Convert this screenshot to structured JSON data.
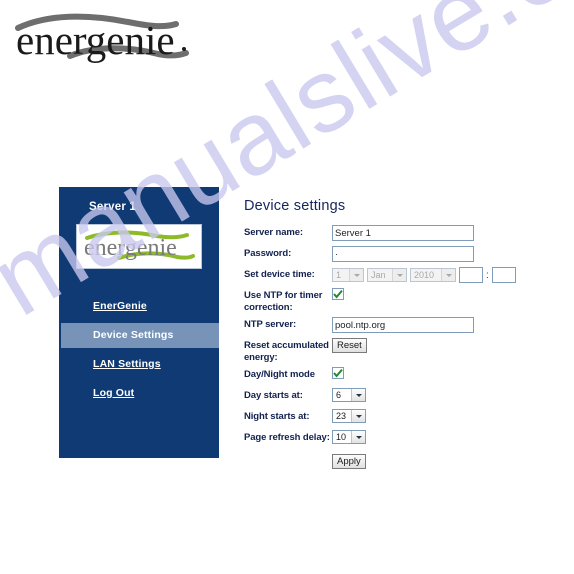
{
  "watermark": {
    "text": "manualslive.com",
    "color": "#c9c9ef"
  },
  "brand": {
    "name": "energenie",
    "wordmark": "energenie"
  },
  "theme": {
    "sidebar_bg": "#0f3a74",
    "sidebar_active_bg": "#7793b8",
    "heading_color": "#15255e",
    "label_color": "#12224f",
    "accent_green": "#8dba29"
  },
  "sidebar": {
    "title": "Server 1",
    "logo_alt": "energenie",
    "items": [
      {
        "label": "EnerGenie",
        "active": false
      },
      {
        "label": "Device Settings",
        "active": true
      },
      {
        "label": "LAN Settings",
        "active": false
      },
      {
        "label": "Log Out",
        "active": false
      }
    ]
  },
  "main": {
    "title": "Device settings",
    "fields": {
      "server_name": {
        "label": "Server name:",
        "value": "Server 1"
      },
      "password": {
        "label": "Password:",
        "value": "·"
      },
      "set_device_time": {
        "label": "Set device time:",
        "day": "1",
        "month": "Jan",
        "year": "2010",
        "hour": "",
        "minute": "",
        "separator": ":",
        "disabled": true
      },
      "use_ntp": {
        "label": "Use NTP for timer correction:",
        "checked": true
      },
      "ntp_server": {
        "label": "NTP server:",
        "value": "pool.ntp.org"
      },
      "reset_energy": {
        "label": "Reset accumulated energy:",
        "button": "Reset"
      },
      "day_night_mode": {
        "label": "Day/Night mode",
        "checked": true
      },
      "day_starts_at": {
        "label": "Day starts at:",
        "value": "6"
      },
      "night_starts_at": {
        "label": "Night starts at:",
        "value": "23"
      },
      "page_refresh_delay": {
        "label": "Page refresh delay:",
        "value": "10"
      }
    },
    "apply_button": "Apply"
  }
}
